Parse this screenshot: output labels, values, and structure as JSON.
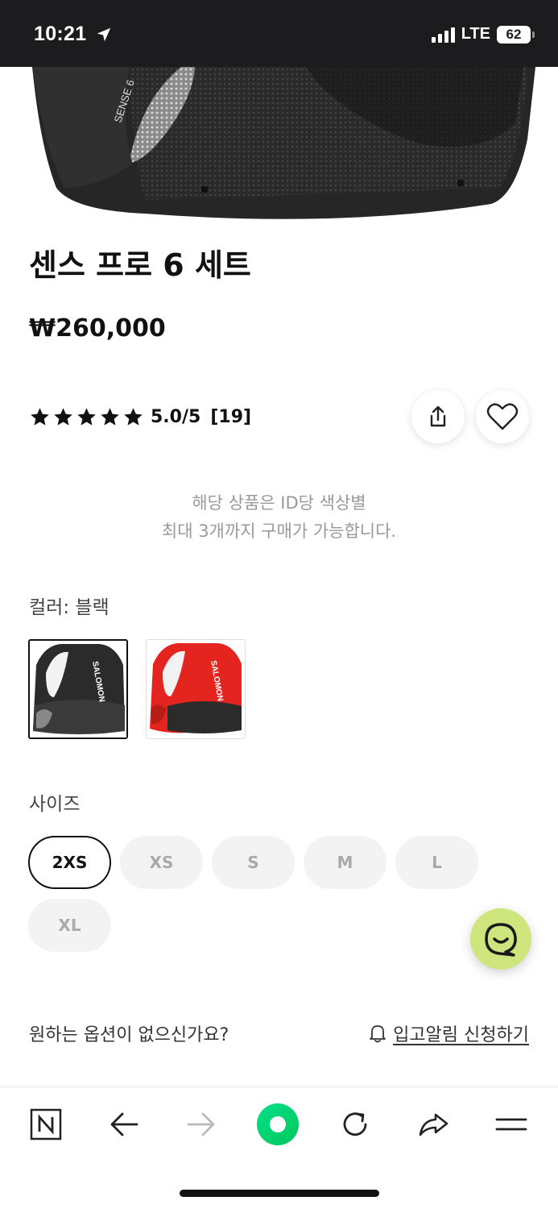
{
  "status_bar": {
    "time": "10:21",
    "network": "LTE",
    "battery": "62"
  },
  "product": {
    "title": "센스 프로 6 세트",
    "price": "₩260,000",
    "rating": "5.0/5",
    "review_count": "[19]",
    "star_count": 5,
    "vest_text": "SENSE 6"
  },
  "notice": {
    "line1": "해당 상품은 ID당 색상별",
    "line2": "최대 3개까지 구매가 가능합니다."
  },
  "color": {
    "label": "컬러: 블랙",
    "options": [
      {
        "name": "블랙",
        "brand_text": "SALOMON",
        "selected": true
      },
      {
        "name": "레드",
        "brand_text": "SALOMON",
        "selected": false
      }
    ]
  },
  "size": {
    "label": "사이즈",
    "options": [
      "2XS",
      "XS",
      "S",
      "M",
      "L",
      "XL"
    ],
    "selected": "2XS"
  },
  "options_footer": {
    "question": "원하는 옵션이 없으신가요?",
    "restock_link": "입고알림 신청하기"
  },
  "icons": {
    "share": "share-icon",
    "wishlist": "heart-icon",
    "chat": "chat-smile-icon",
    "bell": "bell-icon",
    "toolbar": [
      "naver-n-icon",
      "back-arrow-icon",
      "forward-arrow-icon",
      "green-dot-icon",
      "reload-icon",
      "share-arrow-icon",
      "menu-icon"
    ]
  },
  "colors": {
    "chat_bg": "#cde57c",
    "green_button": "#03c75a",
    "red_vest": "#e4251f"
  }
}
